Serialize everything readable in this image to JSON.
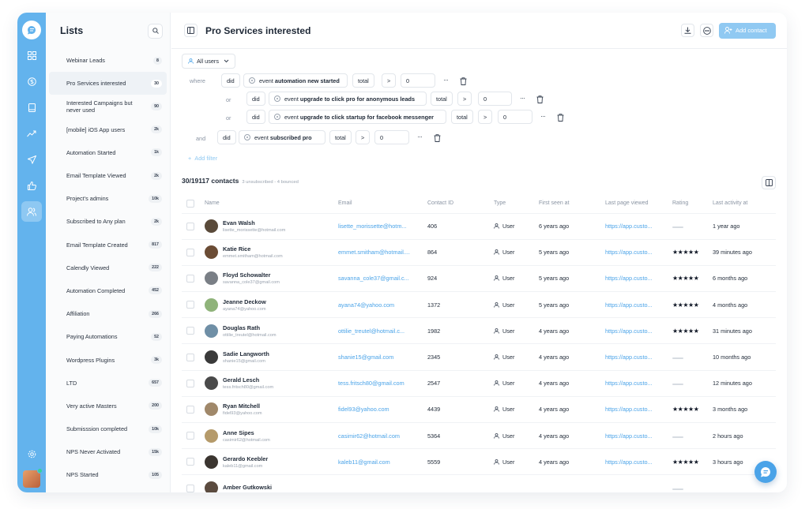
{
  "lists_panel": {
    "title": "Lists",
    "items": [
      {
        "label": "Webinar Leads",
        "badge": "8"
      },
      {
        "label": "Pro Services interested",
        "badge": "30"
      },
      {
        "label": "Interested Campaigns but never used",
        "badge": "90"
      },
      {
        "label": "[mobile] iOS App users",
        "badge": "2k"
      },
      {
        "label": "Automation Started",
        "badge": "1k"
      },
      {
        "label": "Email Template Viewed",
        "badge": "2k"
      },
      {
        "label": "Project's admins",
        "badge": "10k"
      },
      {
        "label": "Subscribed to Any plan",
        "badge": "2k"
      },
      {
        "label": "Email Template Created",
        "badge": "817"
      },
      {
        "label": "Calendly Viewed",
        "badge": "222"
      },
      {
        "label": "Automation Completed",
        "badge": "452"
      },
      {
        "label": "Affiliation",
        "badge": "266"
      },
      {
        "label": "Paying Automations",
        "badge": "52"
      },
      {
        "label": "Wordpress Plugins",
        "badge": "3k"
      },
      {
        "label": "LTD",
        "badge": "657"
      },
      {
        "label": "Very active Masters",
        "badge": "200"
      },
      {
        "label": "Submisssion completed",
        "badge": "10k"
      },
      {
        "label": "NPS Never Activated",
        "badge": "15k"
      },
      {
        "label": "NPS Started",
        "badge": "105"
      }
    ]
  },
  "header": {
    "title": "Pro Services interested",
    "add_contact": "Add contact"
  },
  "filters": {
    "audience": "All users",
    "where": "where",
    "or": "or",
    "and": "and",
    "did": "did",
    "total": "total",
    "gt": ">",
    "zero": "0",
    "event_prefix": "event",
    "events": [
      "automation new started",
      "upgrade to click pro for anonymous leads",
      "upgrade to click startup for facebook messenger",
      "subscribed pro"
    ],
    "add_filter": "Add filter"
  },
  "contacts": {
    "count": "30/19117 contacts",
    "sub": "3 unsubscribed - 4 bounced",
    "columns": [
      "Name",
      "Email",
      "Contact ID",
      "Type",
      "First seen at",
      "Last page viewed",
      "Rating",
      "Last activity at"
    ],
    "rows": [
      {
        "name": "Evan Walsh",
        "sub_email": "lisette_morissette@hotmail.com",
        "email": "lisette_morissette@hotm...",
        "id": "406",
        "type": "User",
        "first_seen": "6 years ago",
        "page": "https://app.custo...",
        "rating": 0,
        "last": "1 year ago"
      },
      {
        "name": "Katie Rice",
        "sub_email": "emmet.smitham@hotmail.com",
        "email": "emmet.smitham@hotmail....",
        "id": "864",
        "type": "User",
        "first_seen": "5 years ago",
        "page": "https://app.custo...",
        "rating": 5,
        "last": "39 minutes ago"
      },
      {
        "name": "Floyd Schowalter",
        "sub_email": "savanna_cole37@gmail.com",
        "email": "savanna_cole37@gmail.c...",
        "id": "924",
        "type": "User",
        "first_seen": "5 years ago",
        "page": "https://app.custo...",
        "rating": 5,
        "last": "6 months ago"
      },
      {
        "name": "Jeanne Deckow",
        "sub_email": "ayana74@yahoo.com",
        "email": "ayana74@yahoo.com",
        "id": "1372",
        "type": "User",
        "first_seen": "5 years ago",
        "page": "https://app.custo...",
        "rating": 5,
        "last": "4 months ago"
      },
      {
        "name": "Douglas Rath",
        "sub_email": "ottilie_treutel@hotmail.com",
        "email": "ottilie_treutel@hotmail.c...",
        "id": "1982",
        "type": "User",
        "first_seen": "4 years ago",
        "page": "https://app.custo...",
        "rating": 5,
        "last": "31 minutes ago"
      },
      {
        "name": "Sadie Langworth",
        "sub_email": "shanie15@gmail.com",
        "email": "shanie15@gmail.com",
        "id": "2345",
        "type": "User",
        "first_seen": "4 years ago",
        "page": "https://app.custo...",
        "rating": 0,
        "last": "10 months ago"
      },
      {
        "name": "Gerald Lesch",
        "sub_email": "tess.fritsch80@gmail.com",
        "email": "tess.fritsch80@gmail.com",
        "id": "2547",
        "type": "User",
        "first_seen": "4 years ago",
        "page": "https://app.custo...",
        "rating": 0,
        "last": "12 minutes ago"
      },
      {
        "name": "Ryan Mitchell",
        "sub_email": "fidel93@yahoo.com",
        "email": "fidel93@yahoo.com",
        "id": "4439",
        "type": "User",
        "first_seen": "4 years ago",
        "page": "https://app.custo...",
        "rating": 5,
        "last": "3 months ago"
      },
      {
        "name": "Anne Sipes",
        "sub_email": "casimir62@hotmail.com",
        "email": "casimir62@hotmail.com",
        "id": "5364",
        "type": "User",
        "first_seen": "4 years ago",
        "page": "https://app.custo...",
        "rating": 0,
        "last": "2 hours ago"
      },
      {
        "name": "Gerardo Keebler",
        "sub_email": "kaleb11@gmail.com",
        "email": "kaleb11@gmail.com",
        "id": "5559",
        "type": "User",
        "first_seen": "4 years ago",
        "page": "https://app.custo...",
        "rating": 5,
        "last": "3 hours ago"
      },
      {
        "name": "Amber Gutkowski",
        "sub_email": "",
        "email": "",
        "id": "",
        "type": "",
        "first_seen": "",
        "page": "",
        "rating": 0,
        "last": ""
      }
    ]
  },
  "colors": {
    "rail": "#63b3ed",
    "accent": "#4aa3e8",
    "button": "#90c9f2"
  }
}
